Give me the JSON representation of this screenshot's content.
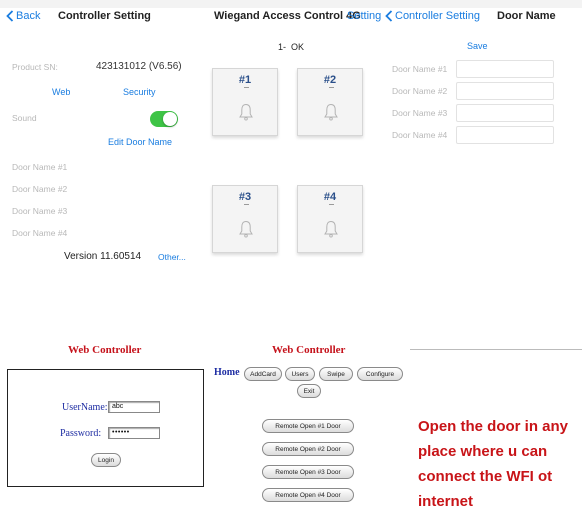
{
  "panel_controller": {
    "back_label": "Back",
    "title": "Controller Setting",
    "product_sn_label": "Product SN:",
    "product_sn_value": "423131012 (V6.56)",
    "web_link": "Web",
    "security_link": "Security",
    "sound_label": "Sound",
    "sound_on": true,
    "edit_door_name_link": "Edit Door Name",
    "door_names": [
      "Door Name #1",
      "Door Name #2",
      "Door Name #3",
      "Door Name #4"
    ],
    "version_text": "Version 11.60514",
    "other_link": "Other..."
  },
  "panel_wiegand": {
    "title": "Wiegand Access Control 4G",
    "setting_link": "Setting",
    "status_text": "1-  OK",
    "doors": [
      "#1",
      "#2",
      "#3",
      "#4"
    ]
  },
  "panel_door_name": {
    "back_label": "Controller Setting",
    "title": "Door Name",
    "save_label": "Save",
    "fields": [
      {
        "label": "Door Name #1",
        "value": ""
      },
      {
        "label": "Door Name #2",
        "value": ""
      },
      {
        "label": "Door Name #3",
        "value": ""
      },
      {
        "label": "Door Name #4",
        "value": ""
      }
    ]
  },
  "web_login": {
    "title": "Web Controller",
    "username_label": "UserName:",
    "username_value": "abc",
    "password_label": "Password:",
    "password_value": "••••••",
    "login_button": "Login"
  },
  "web_controller": {
    "title": "Web Controller",
    "home_link": "Home",
    "nav_buttons": [
      "AddCard",
      "Users",
      "Swipe",
      "Configure",
      "Exit"
    ],
    "remote_buttons": [
      "Remote Open #1 Door",
      "Remote Open #2 Door",
      "Remote Open #3 Door",
      "Remote Open #4 Door"
    ]
  },
  "promo_lines": [
    "Open the door in any",
    "place where u can",
    "connect the WFI ot",
    "internet"
  ],
  "colors": {
    "ios_blue": "#1a7de0",
    "toggle_green": "#3ec446",
    "web_red": "#c5121b",
    "web_blue": "#1f2ea3",
    "door_number_blue": "#2a4f8a",
    "promo_red": "#c81418"
  }
}
